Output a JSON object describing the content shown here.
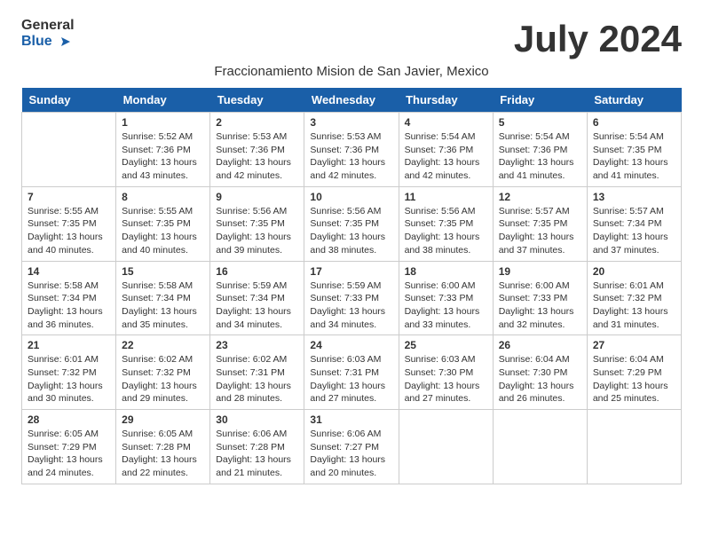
{
  "header": {
    "logo_line1": "General",
    "logo_line2": "Blue",
    "month_year": "July 2024",
    "subtitle": "Fraccionamiento Mision de San Javier, Mexico"
  },
  "days_of_week": [
    "Sunday",
    "Monday",
    "Tuesday",
    "Wednesday",
    "Thursday",
    "Friday",
    "Saturday"
  ],
  "weeks": [
    [
      {
        "day": "",
        "info": ""
      },
      {
        "day": "1",
        "info": "Sunrise: 5:52 AM\nSunset: 7:36 PM\nDaylight: 13 hours\nand 43 minutes."
      },
      {
        "day": "2",
        "info": "Sunrise: 5:53 AM\nSunset: 7:36 PM\nDaylight: 13 hours\nand 42 minutes."
      },
      {
        "day": "3",
        "info": "Sunrise: 5:53 AM\nSunset: 7:36 PM\nDaylight: 13 hours\nand 42 minutes."
      },
      {
        "day": "4",
        "info": "Sunrise: 5:54 AM\nSunset: 7:36 PM\nDaylight: 13 hours\nand 42 minutes."
      },
      {
        "day": "5",
        "info": "Sunrise: 5:54 AM\nSunset: 7:36 PM\nDaylight: 13 hours\nand 41 minutes."
      },
      {
        "day": "6",
        "info": "Sunrise: 5:54 AM\nSunset: 7:35 PM\nDaylight: 13 hours\nand 41 minutes."
      }
    ],
    [
      {
        "day": "7",
        "info": "Sunrise: 5:55 AM\nSunset: 7:35 PM\nDaylight: 13 hours\nand 40 minutes."
      },
      {
        "day": "8",
        "info": "Sunrise: 5:55 AM\nSunset: 7:35 PM\nDaylight: 13 hours\nand 40 minutes."
      },
      {
        "day": "9",
        "info": "Sunrise: 5:56 AM\nSunset: 7:35 PM\nDaylight: 13 hours\nand 39 minutes."
      },
      {
        "day": "10",
        "info": "Sunrise: 5:56 AM\nSunset: 7:35 PM\nDaylight: 13 hours\nand 38 minutes."
      },
      {
        "day": "11",
        "info": "Sunrise: 5:56 AM\nSunset: 7:35 PM\nDaylight: 13 hours\nand 38 minutes."
      },
      {
        "day": "12",
        "info": "Sunrise: 5:57 AM\nSunset: 7:35 PM\nDaylight: 13 hours\nand 37 minutes."
      },
      {
        "day": "13",
        "info": "Sunrise: 5:57 AM\nSunset: 7:34 PM\nDaylight: 13 hours\nand 37 minutes."
      }
    ],
    [
      {
        "day": "14",
        "info": "Sunrise: 5:58 AM\nSunset: 7:34 PM\nDaylight: 13 hours\nand 36 minutes."
      },
      {
        "day": "15",
        "info": "Sunrise: 5:58 AM\nSunset: 7:34 PM\nDaylight: 13 hours\nand 35 minutes."
      },
      {
        "day": "16",
        "info": "Sunrise: 5:59 AM\nSunset: 7:34 PM\nDaylight: 13 hours\nand 34 minutes."
      },
      {
        "day": "17",
        "info": "Sunrise: 5:59 AM\nSunset: 7:33 PM\nDaylight: 13 hours\nand 34 minutes."
      },
      {
        "day": "18",
        "info": "Sunrise: 6:00 AM\nSunset: 7:33 PM\nDaylight: 13 hours\nand 33 minutes."
      },
      {
        "day": "19",
        "info": "Sunrise: 6:00 AM\nSunset: 7:33 PM\nDaylight: 13 hours\nand 32 minutes."
      },
      {
        "day": "20",
        "info": "Sunrise: 6:01 AM\nSunset: 7:32 PM\nDaylight: 13 hours\nand 31 minutes."
      }
    ],
    [
      {
        "day": "21",
        "info": "Sunrise: 6:01 AM\nSunset: 7:32 PM\nDaylight: 13 hours\nand 30 minutes."
      },
      {
        "day": "22",
        "info": "Sunrise: 6:02 AM\nSunset: 7:32 PM\nDaylight: 13 hours\nand 29 minutes."
      },
      {
        "day": "23",
        "info": "Sunrise: 6:02 AM\nSunset: 7:31 PM\nDaylight: 13 hours\nand 28 minutes."
      },
      {
        "day": "24",
        "info": "Sunrise: 6:03 AM\nSunset: 7:31 PM\nDaylight: 13 hours\nand 27 minutes."
      },
      {
        "day": "25",
        "info": "Sunrise: 6:03 AM\nSunset: 7:30 PM\nDaylight: 13 hours\nand 27 minutes."
      },
      {
        "day": "26",
        "info": "Sunrise: 6:04 AM\nSunset: 7:30 PM\nDaylight: 13 hours\nand 26 minutes."
      },
      {
        "day": "27",
        "info": "Sunrise: 6:04 AM\nSunset: 7:29 PM\nDaylight: 13 hours\nand 25 minutes."
      }
    ],
    [
      {
        "day": "28",
        "info": "Sunrise: 6:05 AM\nSunset: 7:29 PM\nDaylight: 13 hours\nand 24 minutes."
      },
      {
        "day": "29",
        "info": "Sunrise: 6:05 AM\nSunset: 7:28 PM\nDaylight: 13 hours\nand 22 minutes."
      },
      {
        "day": "30",
        "info": "Sunrise: 6:06 AM\nSunset: 7:28 PM\nDaylight: 13 hours\nand 21 minutes."
      },
      {
        "day": "31",
        "info": "Sunrise: 6:06 AM\nSunset: 7:27 PM\nDaylight: 13 hours\nand 20 minutes."
      },
      {
        "day": "",
        "info": ""
      },
      {
        "day": "",
        "info": ""
      },
      {
        "day": "",
        "info": ""
      }
    ]
  ]
}
